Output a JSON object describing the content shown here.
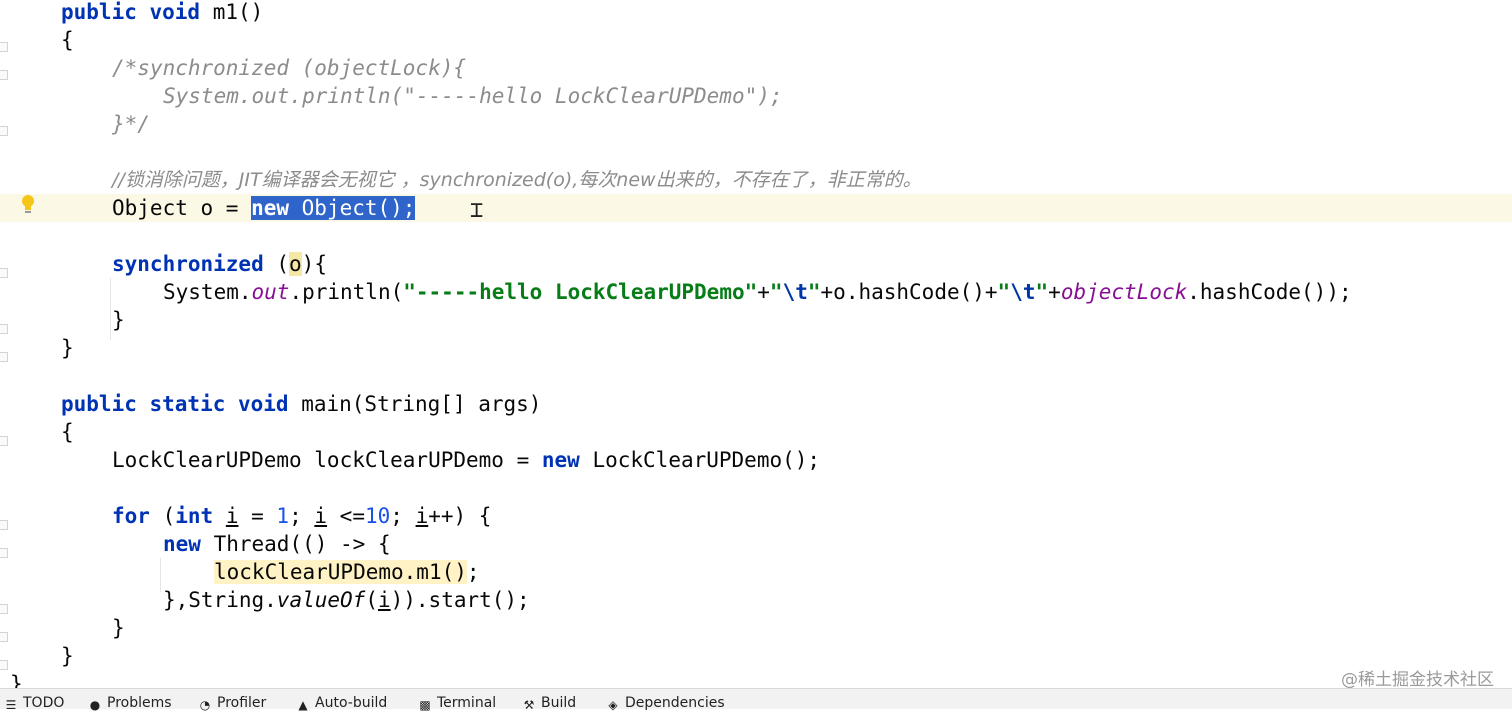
{
  "editor": {
    "lines": {
      "l1": {
        "kw1": "public void",
        "rest": " m1()"
      },
      "l2": "{",
      "l3": "/*synchronized (objectLock){",
      "l4": "System.out.println(\"-----hello LockClearUPDemo\");",
      "l5": "}*/",
      "l7": {
        "a": "//锁消除问题，JIT编译器会无视它 ，synchronized(o),每次new出来的，不存在了，非正常的。"
      },
      "l8": {
        "a": "Object o = ",
        "sel_kw": "new",
        "sel_rest": " Object();"
      },
      "l10": {
        "kw": "synchronized",
        "a": " (",
        "b": "o",
        "c": "){"
      },
      "l11": {
        "a": "System.",
        "out": "out",
        "b": ".println(",
        "s1": "\"-----hello LockClearUPDemo\"",
        "c": "+",
        "s2a": "\"",
        "esc1": "\\t",
        "s2b": "\"",
        "d": "+o.hashCode()+",
        "s3a": "\"",
        "esc2": "\\t",
        "s3b": "\"",
        "e": "+",
        "fld": "objectLock",
        "f": ".hashCode());"
      },
      "l12": "}",
      "l13": "}",
      "l15": {
        "kw": "public static void",
        "a": " main(String[] args)"
      },
      "l16": "{",
      "l17": {
        "a": "LockClearUPDemo lockClearUPDemo = ",
        "kw": "new",
        "b": " LockClearUPDemo();"
      },
      "l19": {
        "kw1": "for",
        "a": " (",
        "kw2": "int",
        "b": " ",
        "i1": "i",
        "c": " = ",
        "n1": "1",
        "d": "; ",
        "i2": "i",
        "e": " <=",
        "n2": "10",
        "f": "; ",
        "i3": "i",
        "g": "++) {"
      },
      "l20": {
        "kw": "new",
        "a": " Thread(() -> {"
      },
      "l21": {
        "a": "lockClearUPDemo",
        "b": ".m1()",
        "c": ";"
      },
      "l22": {
        "a": "},String.",
        "it": "valueOf",
        "b": "(",
        "i": "i",
        "c": ")).start();"
      },
      "l23": "}",
      "l24": "}",
      "l25": "}"
    },
    "intention_icon": "lightbulb-icon",
    "cursor_icon": "text-cursor-icon",
    "colors": {
      "keyword": "#0033b3",
      "comment": "#8c8c8c",
      "string": "#067d17",
      "selection": "#2f65ca",
      "current_line": "#fcf8e6"
    }
  },
  "watermark": "@稀土掘金技术社区",
  "statusbar": {
    "items": [
      {
        "icon": "list-icon",
        "label": "TODO"
      },
      {
        "icon": "problems-icon",
        "label": "Problems"
      },
      {
        "icon": "profiler-icon",
        "label": "Profiler"
      },
      {
        "icon": "auto-build-icon",
        "label": "Auto-build"
      },
      {
        "icon": "terminal-icon",
        "label": "Terminal"
      },
      {
        "icon": "hammer-icon",
        "label": "Build"
      },
      {
        "icon": "dependencies-icon",
        "label": "Dependencies"
      }
    ]
  }
}
